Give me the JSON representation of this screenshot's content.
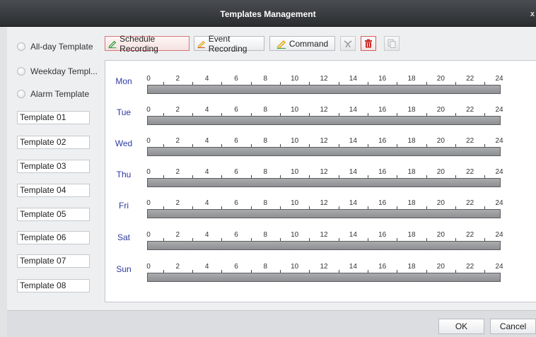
{
  "window": {
    "title": "Templates Management",
    "close_glyph": "x"
  },
  "left_panel": {
    "radios": [
      {
        "label": "All-day Template"
      },
      {
        "label": "Weekday Templ..."
      },
      {
        "label": "Alarm Template"
      }
    ],
    "templates": [
      "Template 01",
      "Template 02",
      "Template 03",
      "Template 04",
      "Template 05",
      "Template 06",
      "Template 07",
      "Template 08"
    ]
  },
  "toolbar": {
    "schedule_recording": "Schedule Recording",
    "event_recording": "Event Recording",
    "command": "Command",
    "icons": [
      "clear-icon",
      "delete-icon",
      "copy-icon"
    ],
    "colors": {
      "schedule_pen": "#2f9e3a",
      "event_pen": "#e0a400",
      "command_pen": "#3aa33a",
      "delete_red": "#cc2a2a"
    }
  },
  "schedule": {
    "days": [
      "Mon",
      "Tue",
      "Wed",
      "Thu",
      "Fri",
      "Sat",
      "Sun"
    ],
    "hour_labels": [
      "0",
      "2",
      "4",
      "6",
      "8",
      "10",
      "12",
      "14",
      "16",
      "18",
      "20",
      "22",
      "24"
    ]
  },
  "footer": {
    "ok": "OK",
    "cancel": "Cancel"
  }
}
